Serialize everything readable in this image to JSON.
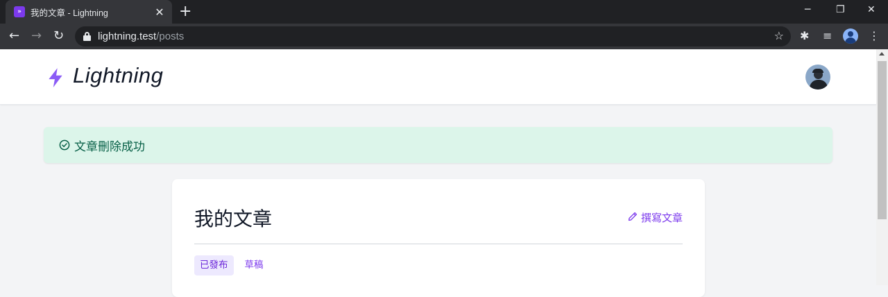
{
  "browser": {
    "tab_title": "我的文章 - Lightning",
    "favicon_glyph": "»",
    "close_glyph": "✕",
    "new_tab_glyph": "+",
    "url_host": "lightning.test",
    "url_path": "/posts",
    "window_controls": {
      "minimize": "─",
      "restore": "❐",
      "close": "✕"
    },
    "nav": {
      "back": "←",
      "forward": "→",
      "reload": "↻"
    },
    "star_glyph": "☆",
    "extensions_glyph": "✱",
    "media_glyph": "≡",
    "menu_glyph": "⋮"
  },
  "site": {
    "logo_text": "Lightning",
    "brand_color": "#8b5cf6"
  },
  "alert": {
    "message": "文章刪除成功",
    "icon": "check-circle-icon",
    "color": "#065f46"
  },
  "card": {
    "title": "我的文章",
    "write_label": "撰寫文章",
    "tabs": [
      {
        "label": "已發布",
        "active": true
      },
      {
        "label": "草稿",
        "active": false
      }
    ]
  }
}
